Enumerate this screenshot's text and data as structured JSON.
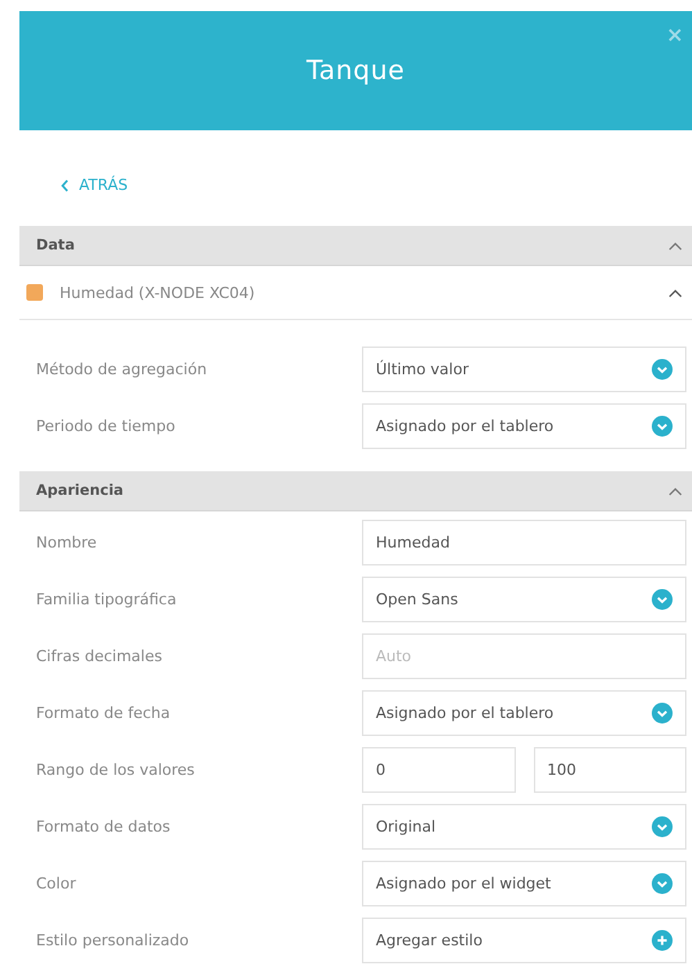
{
  "header": {
    "title": "Tanque",
    "close": "×"
  },
  "back_link": {
    "label": "ATRÁS"
  },
  "sections": [
    {
      "title": "Data",
      "expanded": true,
      "series": {
        "name": "Humedad (X-NODE XC04)",
        "color": "#f2a85a",
        "expanded": true
      },
      "fields": [
        {
          "label": "Método de agregación",
          "kind": "select",
          "value": "Último valor"
        },
        {
          "label": "Periodo de tiempo",
          "kind": "select",
          "value": "Asignado por el tablero"
        }
      ]
    },
    {
      "title": "Apariencia",
      "expanded": true,
      "fields": [
        {
          "label": "Nombre",
          "kind": "text",
          "value": "Humedad"
        },
        {
          "label": "Familia tipográfica",
          "kind": "select",
          "value": "Open Sans"
        },
        {
          "label": "Cifras decimales",
          "kind": "text",
          "placeholder": "Auto"
        },
        {
          "label": "Formato de fecha",
          "kind": "select",
          "value": "Asignado por el tablero"
        },
        {
          "label": "Rango de los valores",
          "kind": "range",
          "min": "0",
          "max": "100"
        },
        {
          "label": "Formato de datos",
          "kind": "select",
          "value": "Original"
        },
        {
          "label": "Color",
          "kind": "select",
          "value": "Asignado por el widget"
        },
        {
          "label": "Estilo personalizado",
          "kind": "add",
          "value": "Agregar estilo"
        }
      ]
    }
  ]
}
